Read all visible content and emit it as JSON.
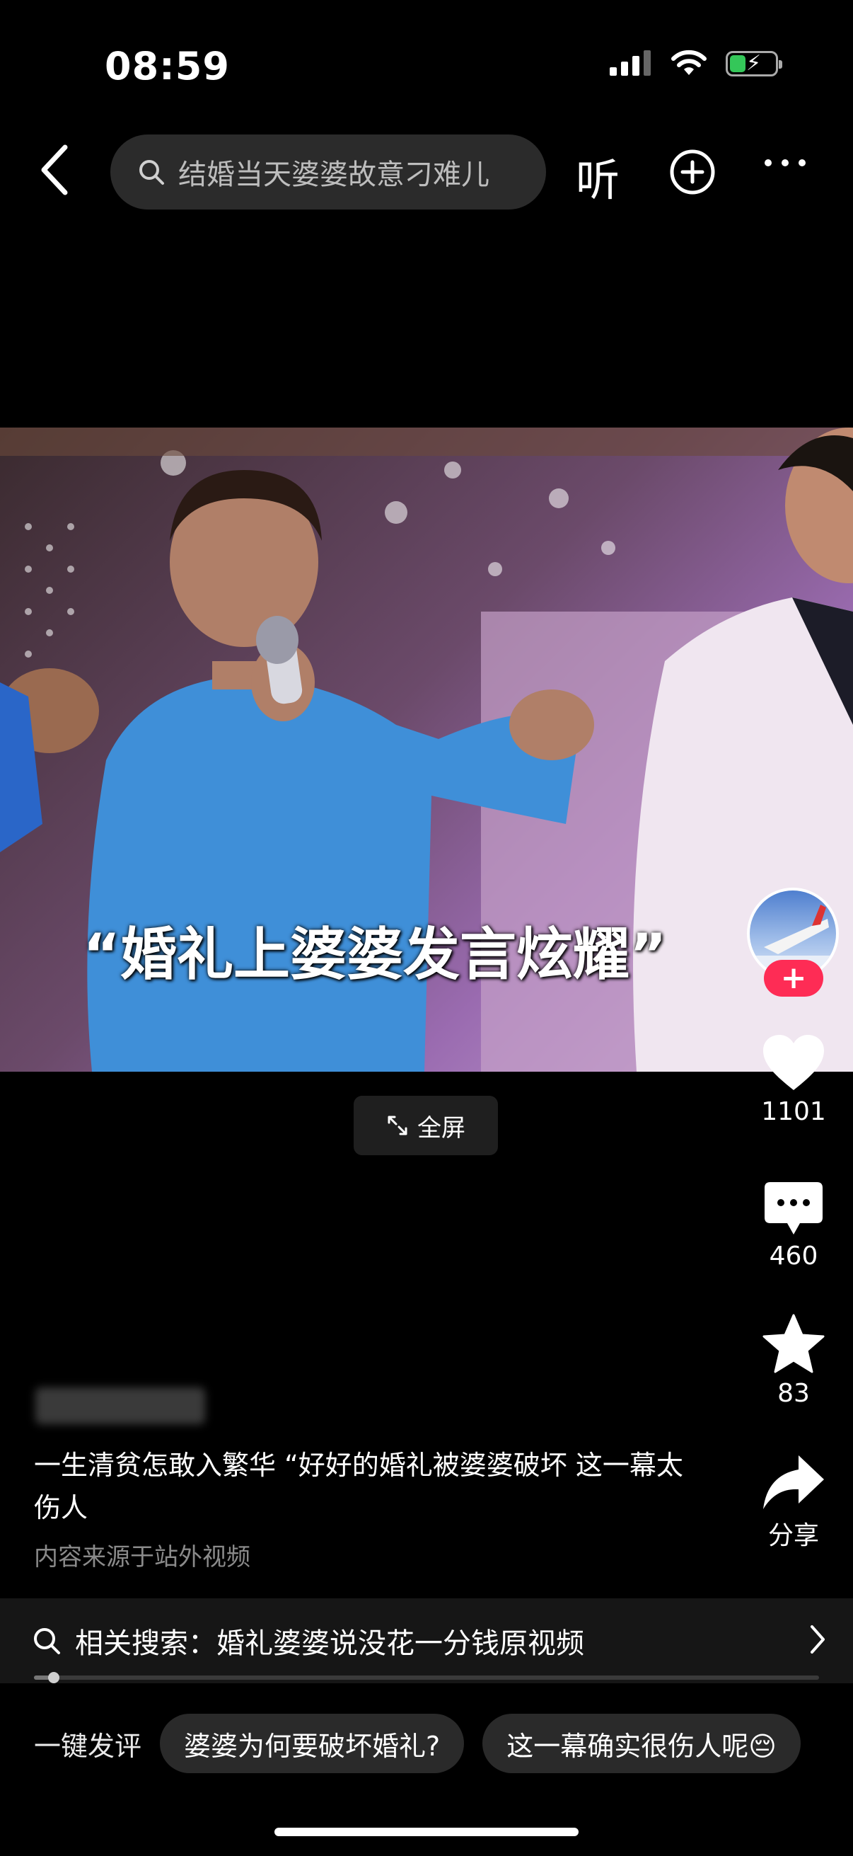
{
  "status_bar": {
    "time": "08:59"
  },
  "top_nav": {
    "search_text": "结婚当天婆婆故意刁难儿",
    "listen_label": "听"
  },
  "video": {
    "subtitle": "“婚礼上婆婆发言炫耀”",
    "fullscreen_label": "全屏"
  },
  "side_rail": {
    "like_count": "1101",
    "comment_count": "460",
    "favorite_count": "83",
    "share_label": "分享",
    "follow_plus": "+"
  },
  "post": {
    "description": "一生清贫怎敢入繁华 “好好的婚礼被婆婆破坏 这一幕太伤人",
    "source": "内容来源于站外视频"
  },
  "related_search": {
    "label": "相关搜索：",
    "query": "婚礼婆婆说没花一分钱原视频",
    "progress": 0.02
  },
  "quick_comment": {
    "label": "一键发评",
    "chips": [
      "婆婆为何要破坏婚礼?",
      "这一幕确实很伤人呢😔"
    ]
  },
  "colors": {
    "follow": "#fe2c55",
    "battery": "#34c759"
  }
}
